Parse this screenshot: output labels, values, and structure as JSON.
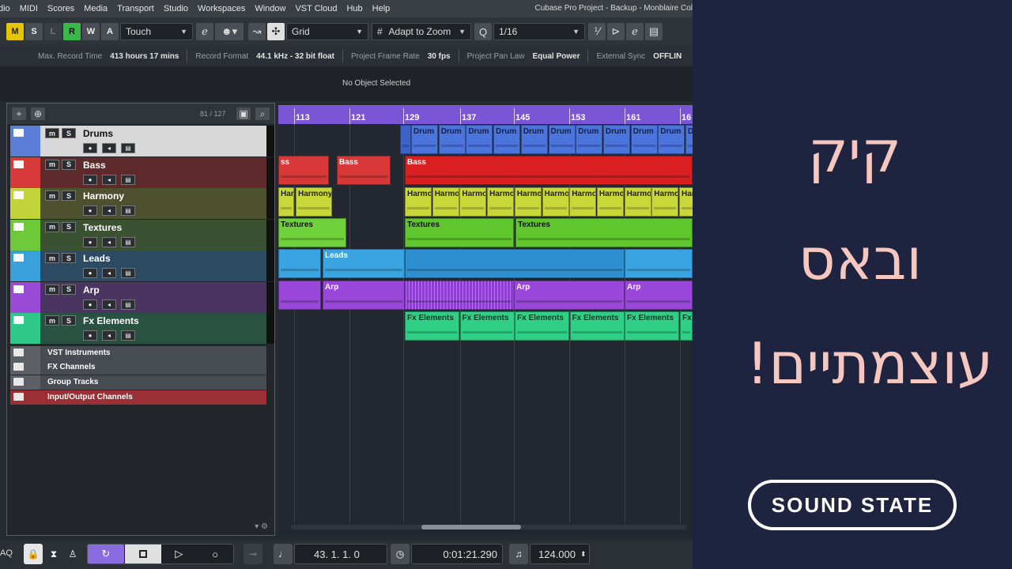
{
  "menu": [
    "dio",
    "MIDI",
    "Scores",
    "Media",
    "Transport",
    "Studio",
    "Workspaces",
    "Window",
    "VST Cloud",
    "Hub",
    "Help"
  ],
  "window_title": "Cubase Pro Project - Backup - Monblaire Col",
  "toolbar": {
    "mode_buttons": [
      "M",
      "S",
      "L",
      "R",
      "W",
      "A"
    ],
    "automation_mode": "Touch",
    "snap_type": "Grid",
    "grid_mode": "Adapt to Zoom",
    "quantize_label": "Q",
    "quantize_value": "1/16"
  },
  "info_line": [
    {
      "key": "Max. Record Time",
      "value": "413 hours 17 mins"
    },
    {
      "key": "Record Format",
      "value": "44.1 kHz - 32 bit float"
    },
    {
      "key": "Project Frame Rate",
      "value": "30 fps"
    },
    {
      "key": "Project Pan Law",
      "value": "Equal Power"
    },
    {
      "key": "External Sync",
      "value": "OFFLIN"
    }
  ],
  "object_line": "No Object Selected",
  "tracklist": {
    "count": "81 / 127",
    "tracks": [
      {
        "name": "Drums",
        "color": "#5b7fd6",
        "body": "#d8d8d8",
        "dark_text": true
      },
      {
        "name": "Bass",
        "color": "#d63a3a",
        "body": "#5e2a2c"
      },
      {
        "name": "Harmony",
        "color": "#c3d43a",
        "body": "#4d5130"
      },
      {
        "name": "Textures",
        "color": "#6ec93a",
        "body": "#3a5232"
      },
      {
        "name": "Leads",
        "color": "#3aa0dc",
        "body": "#2c4b63"
      },
      {
        "name": "Arp",
        "color": "#9a4ad6",
        "body": "#4a3460"
      },
      {
        "name": "Fx Elements",
        "color": "#2ec98a",
        "body": "#2a5243"
      }
    ],
    "folders": [
      {
        "name": "VST Instruments"
      },
      {
        "name": "FX Channels"
      },
      {
        "name": "Group Tracks"
      },
      {
        "name": "Input/Output Channels",
        "color": "#9a2f35"
      }
    ]
  },
  "ruler": {
    "bars": [
      "113",
      "121",
      "129",
      "137",
      "145",
      "153",
      "161",
      "16"
    ]
  },
  "clips": {
    "drums": "Drum",
    "bass": [
      "ss",
      "Bass",
      "Bass"
    ],
    "harmony": [
      "Harmo",
      "Harmony",
      "Harmo"
    ],
    "textures": [
      "Textures",
      "Textures",
      "Textures"
    ],
    "leads": "Leads",
    "arp": [
      "Arp",
      "Arp",
      "Arp"
    ],
    "fx": "Fx Elements",
    "fx_cut": "Fx"
  },
  "transport": {
    "left_label": "AQ",
    "position_bars": "43.  1.  1.    0",
    "position_time": "0:01:21.290",
    "tempo": "124.000"
  },
  "panel": {
    "line1": "קיק",
    "line2": "ובאס",
    "line3": "עוצמתיים!",
    "logo": "SOUND STATE"
  }
}
